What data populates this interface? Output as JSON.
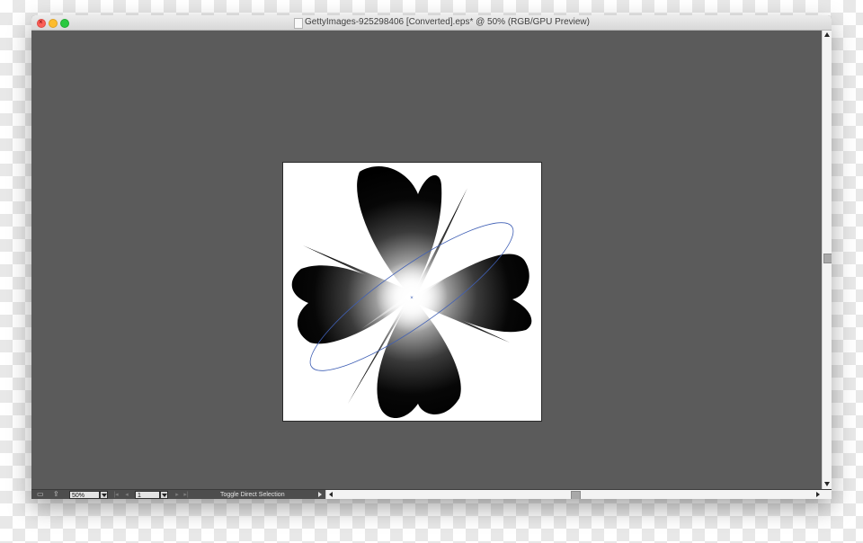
{
  "window": {
    "title": "GettyImages-925298406 [Converted].eps* @ 50% (RGB/GPU Preview)",
    "traffic_lights": [
      "close",
      "minimize",
      "maximize"
    ]
  },
  "canvas": {
    "background": "#5b5b5b",
    "artboard_color": "#ffffff",
    "artwork": "black-flower-with-radial-white-glow",
    "selection_color": "#3f5fb5"
  },
  "statusbar": {
    "zoom": "50%",
    "page": "1",
    "status_text": "Toggle Direct Selection",
    "icons": [
      "artboard-icon",
      "share-icon",
      "first-page-icon",
      "prev-page-icon",
      "next-page-icon",
      "last-page-icon"
    ]
  },
  "colors": {
    "close": "#fc5f57",
    "minimize": "#fdbc2e",
    "maximize": "#29c940"
  }
}
